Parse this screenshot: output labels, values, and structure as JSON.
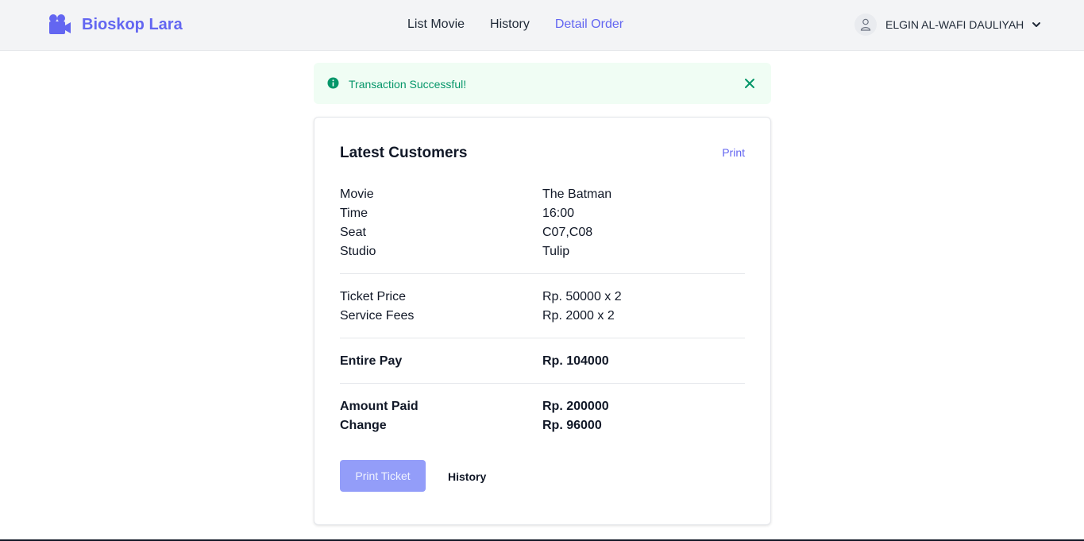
{
  "brand": {
    "name": "Bioskop Lara",
    "icon": "video-camera-icon",
    "color": "#6366f1"
  },
  "nav": {
    "links": [
      {
        "label": "List Movie",
        "active": false
      },
      {
        "label": "History",
        "active": false
      },
      {
        "label": "Detail Order",
        "active": true
      }
    ]
  },
  "user": {
    "name": "ELGIN AL-WAFI DAULIYAH",
    "icon": "user-icon",
    "dropdown_icon": "chevron-down-icon"
  },
  "alert": {
    "message": "Transaction Successful!",
    "icon": "info-circle-icon",
    "close_icon": "close-icon",
    "color": "#059669"
  },
  "card": {
    "title": "Latest Customers",
    "print_label": "Print",
    "details": [
      {
        "label": "Movie",
        "value": "The Batman"
      },
      {
        "label": "Time",
        "value": "16:00"
      },
      {
        "label": "Seat",
        "value": "C07,C08"
      },
      {
        "label": "Studio",
        "value": "Tulip"
      }
    ],
    "fees": [
      {
        "label": "Ticket Price",
        "value": "Rp. 50000 x 2"
      },
      {
        "label": "Service Fees",
        "value": "Rp. 2000 x 2"
      }
    ],
    "total": {
      "label": "Entire Pay",
      "value": "Rp. 104000"
    },
    "payment": [
      {
        "label": "Amount Paid",
        "value": "Rp. 200000"
      },
      {
        "label": "Change",
        "value": "Rp. 96000"
      }
    ],
    "print_ticket_label": "Print Ticket",
    "history_label": "History"
  }
}
